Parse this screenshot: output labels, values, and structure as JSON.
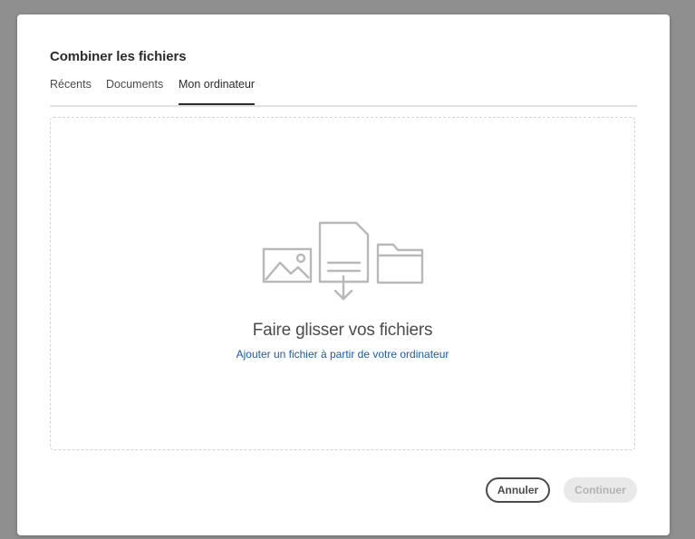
{
  "dialog": {
    "title": "Combiner les fichiers"
  },
  "tabs": [
    {
      "label": "Récents",
      "selected": false
    },
    {
      "label": "Documents",
      "selected": false
    },
    {
      "label": "Mon ordinateur",
      "selected": true
    }
  ],
  "dropzone": {
    "heading": "Faire glisser vos fichiers",
    "link": "Ajouter un fichier à partir de votre ordinateur",
    "icons": [
      "image-icon",
      "document-download-icon",
      "folder-icon"
    ]
  },
  "footer": {
    "cancel_label": "Annuler",
    "continue_label": "Continuer",
    "continue_disabled": true
  },
  "colors": {
    "link": "#1a5aa6",
    "icon_stroke": "#b8b8b8",
    "text": "#2c2c2c"
  }
}
